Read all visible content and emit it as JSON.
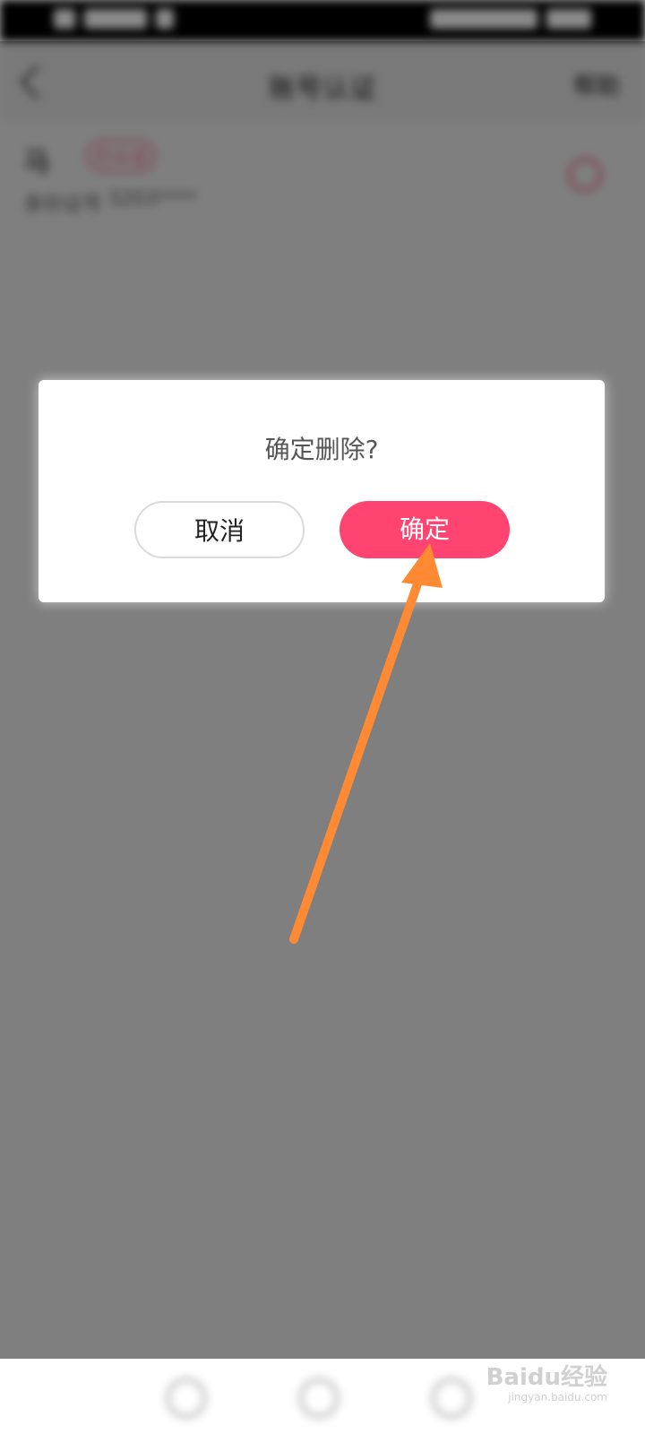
{
  "background_app": {
    "header_title": "账号认证",
    "header_action": "帮助",
    "account_name": "马",
    "account_tag": "已认证",
    "account_label": "身份证号",
    "account_value": "3203****"
  },
  "dialog": {
    "message": "确定删除?",
    "cancel_label": "取消",
    "confirm_label": "确定"
  },
  "colors": {
    "confirm_button": "#ff4471",
    "arrow": "#ff8a33",
    "overlay": "rgba(0,0,0,0.5)"
  },
  "watermark": {
    "brand": "Baidu经验",
    "url": "jingyan.baidu.com"
  }
}
